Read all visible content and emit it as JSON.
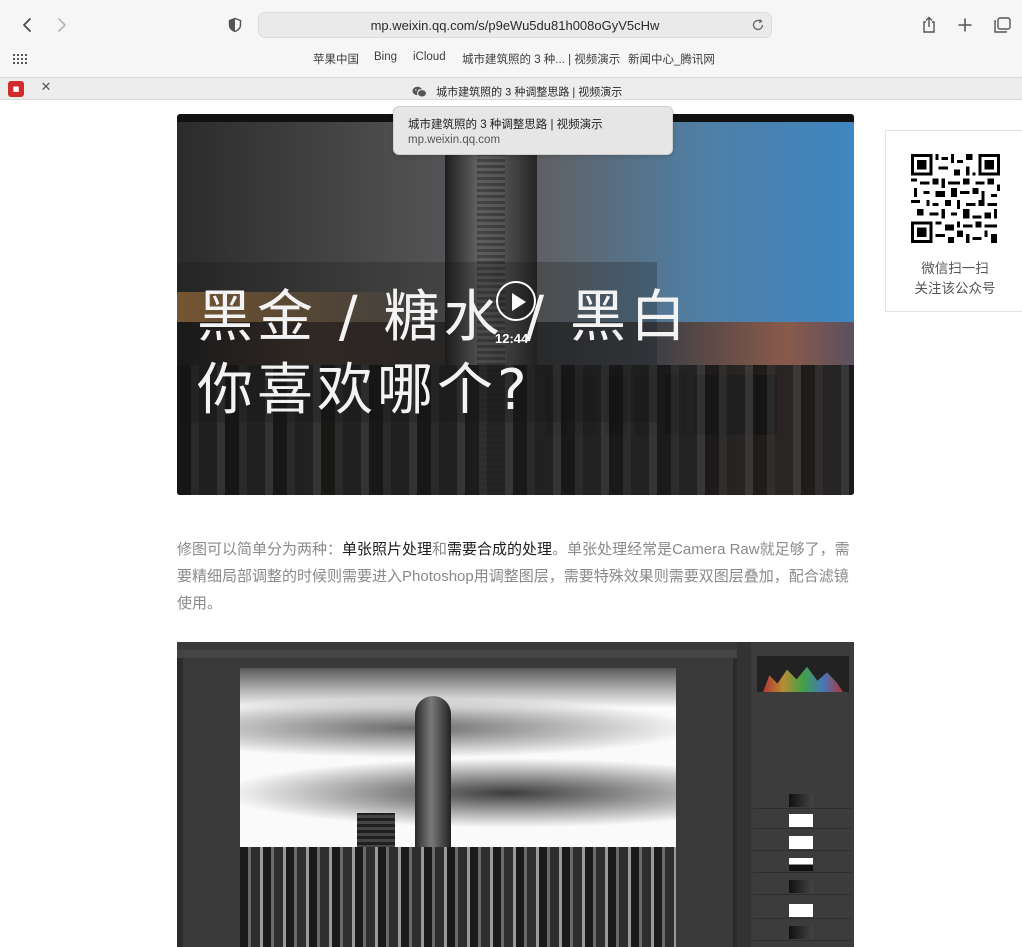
{
  "browser": {
    "url": "mp.weixin.qq.com/s/p9eWu5du81h008oGyV5cHw",
    "bookmarks": [
      "苹果中国",
      "Bing",
      "iCloud",
      "城市建筑照的 3 种... | 视频演示",
      "新闻中心_腾讯网"
    ],
    "tab_title": "城市建筑照的 3 种调整思路 | 视频演示"
  },
  "tooltip": {
    "title": "城市建筑照的 3 种调整思路 | 视频演示",
    "domain": "mp.weixin.qq.com"
  },
  "video": {
    "line1": "黑金 / 糖水 / 黑白",
    "line2": "你喜欢哪个?",
    "duration": "12:44"
  },
  "qr": {
    "caption1": "微信扫一扫",
    "caption2": "关注该公众号"
  },
  "article": {
    "p1_a": "修图可以简单分为两种：",
    "p1_b": "单张照片处理",
    "p1_c": "和",
    "p1_d": "需要合成的处理",
    "p1_e": "。单张处理经常是Camera Raw就足够了，需要精细局部调整的时候则需要进入Photoshop用调整图层，需要特殊效果则需要双图层叠加，配合滤镜使用。"
  },
  "icons": [
    "back-icon",
    "forward-icon",
    "privacy-shield-icon",
    "reload-icon",
    "share-icon",
    "new-tab-icon",
    "tab-overview-icon",
    "bookmarks-grid-icon",
    "wechat-icon",
    "close-icon",
    "play-icon",
    "qr-code"
  ]
}
